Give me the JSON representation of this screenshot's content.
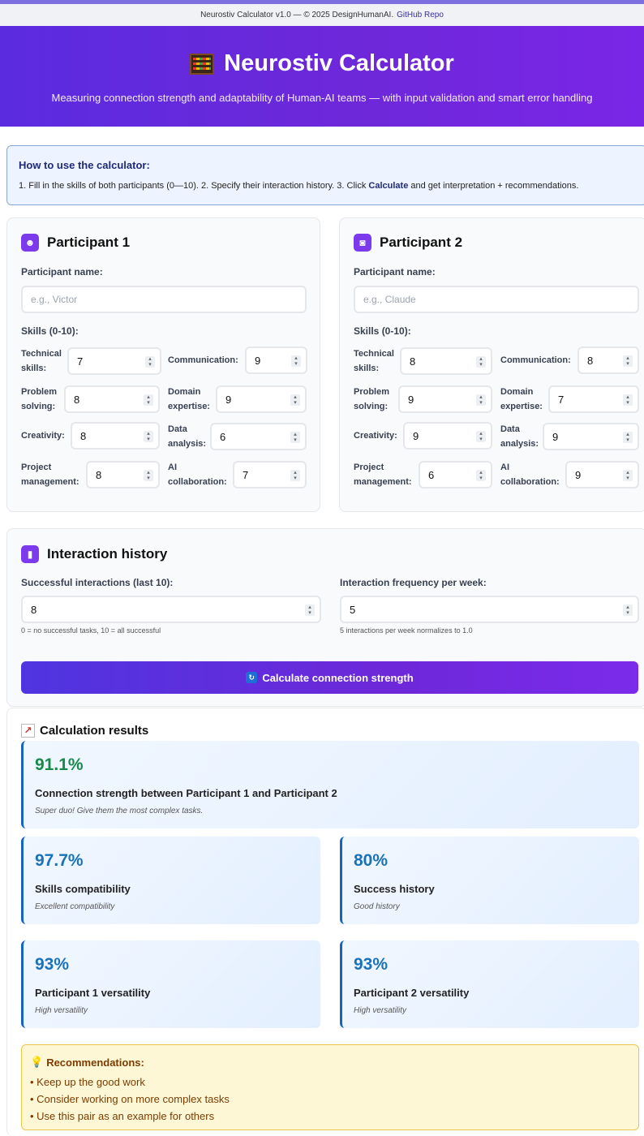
{
  "topbar": {
    "text": "Neurostiv Calculator v1.0 — © 2025 DesignHumanAI.",
    "link": "GitHub Repo"
  },
  "hero": {
    "title": "Neurostiv Calculator",
    "subtitle": "Measuring connection strength and adaptability of Human-AI teams — with input validation and smart error handling"
  },
  "howto": {
    "heading": "How to use the calculator:",
    "text_before": "1. Fill in the skills of both participants (0—10). 2. Specify their interaction history. 3. Click ",
    "bold": "Calculate",
    "text_after": " and get interpretation + recommendations."
  },
  "participants": [
    {
      "title": "Participant 1",
      "icon": "person-icon",
      "name_label": "Participant name:",
      "name_placeholder": "e.g., Victor",
      "skills_label": "Skills (0-10):",
      "skills": [
        {
          "l1": "Technical",
          "l2": "skills:",
          "value": "7"
        },
        {
          "l1": "Communication:",
          "l2": "",
          "value": "9"
        },
        {
          "l1": "Problem",
          "l2": "solving:",
          "value": "8"
        },
        {
          "l1": "Domain",
          "l2": "expertise:",
          "value": "9"
        },
        {
          "l1": "Creativity:",
          "l2": "",
          "value": "8"
        },
        {
          "l1": "Data",
          "l2": "analysis:",
          "value": "6"
        },
        {
          "l1": "Project",
          "l2": "management:",
          "value": "8"
        },
        {
          "l1": "AI",
          "l2": "collaboration:",
          "value": "7"
        }
      ]
    },
    {
      "title": "Participant 2",
      "icon": "robot-icon",
      "name_label": "Participant name:",
      "name_placeholder": "e.g., Claude",
      "skills_label": "Skills (0-10):",
      "skills": [
        {
          "l1": "Technical",
          "l2": "skills:",
          "value": "8"
        },
        {
          "l1": "Communication:",
          "l2": "",
          "value": "8"
        },
        {
          "l1": "Problem",
          "l2": "solving:",
          "value": "9"
        },
        {
          "l1": "Domain",
          "l2": "expertise:",
          "value": "7"
        },
        {
          "l1": "Creativity:",
          "l2": "",
          "value": "9"
        },
        {
          "l1": "Data",
          "l2": "analysis:",
          "value": "9"
        },
        {
          "l1": "Project",
          "l2": "management:",
          "value": "6"
        },
        {
          "l1": "AI",
          "l2": "collaboration:",
          "value": "9"
        }
      ]
    }
  ],
  "history": {
    "title": "Interaction history",
    "success_label": "Successful interactions (last 10):",
    "success_value": "8",
    "success_hint": "0 = no successful tasks, 10 = all successful",
    "freq_label": "Interaction frequency per week:",
    "freq_value": "5",
    "freq_hint": "5 interactions per week normalizes to 1.0",
    "button": "Calculate connection strength"
  },
  "results": {
    "title": "Calculation results",
    "main": {
      "value": "91.1%",
      "caption": "Connection strength between Participant 1 and Participant 2",
      "note": "Super duo! Give them the most complex tasks."
    },
    "cards": [
      {
        "value": "97.7%",
        "caption": "Skills compatibility",
        "note": "Excellent compatibility"
      },
      {
        "value": "80%",
        "caption": "Success history",
        "note": "Good history"
      },
      {
        "value": "93%",
        "caption": "Participant 1 versatility",
        "note": "High versatility"
      },
      {
        "value": "93%",
        "caption": "Participant 2 versatility",
        "note": "High versatility"
      }
    ],
    "main_value_color": "#178a4a",
    "card_value_color": "#1a73b8"
  },
  "recommendations": {
    "title": "Recommendations:",
    "items": [
      "• Keep up the good work",
      "• Consider working on more complex tasks",
      "• Use this pair as an example for others"
    ]
  }
}
